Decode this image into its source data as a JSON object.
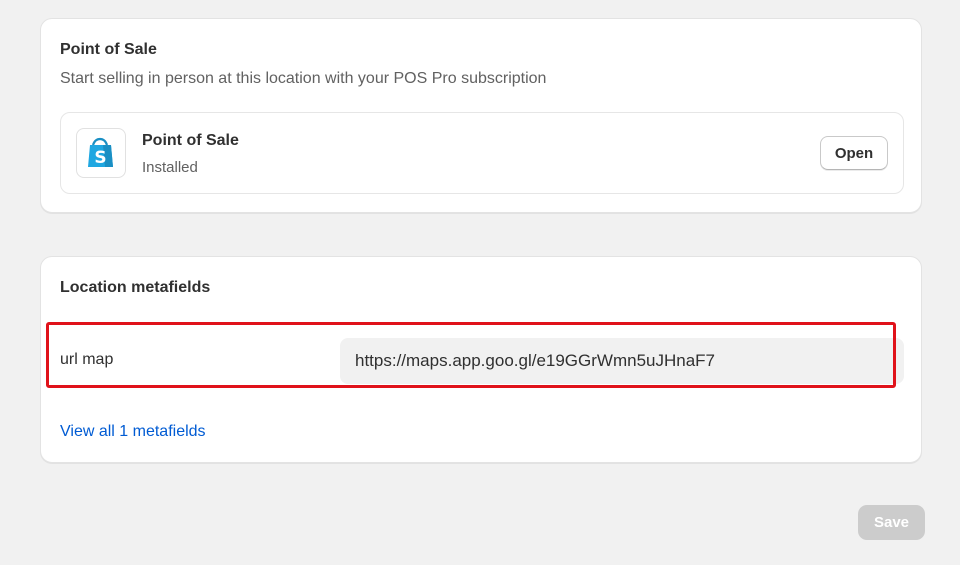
{
  "pos_card": {
    "title": "Point of Sale",
    "subtitle": "Start selling in person at this location with your POS Pro subscription",
    "app": {
      "icon": "shopify-bag-icon",
      "name": "Point of Sale",
      "status": "Installed",
      "open_label": "Open"
    }
  },
  "metafields_card": {
    "title": "Location metafields",
    "fields": [
      {
        "label": "url map",
        "value": "https://maps.app.goo.gl/e19GGrWmn5uJHnaF7"
      }
    ],
    "view_all_label": "View all 1 metafields"
  },
  "footer": {
    "save_label": "Save"
  },
  "colors": {
    "page_bg": "#f1f1f1",
    "link": "#005bd3",
    "highlight": "#e0121a",
    "shopify_green": "#95bf47",
    "pos_blue": "#1fa7e1",
    "save_disabled": "#cccccc"
  }
}
